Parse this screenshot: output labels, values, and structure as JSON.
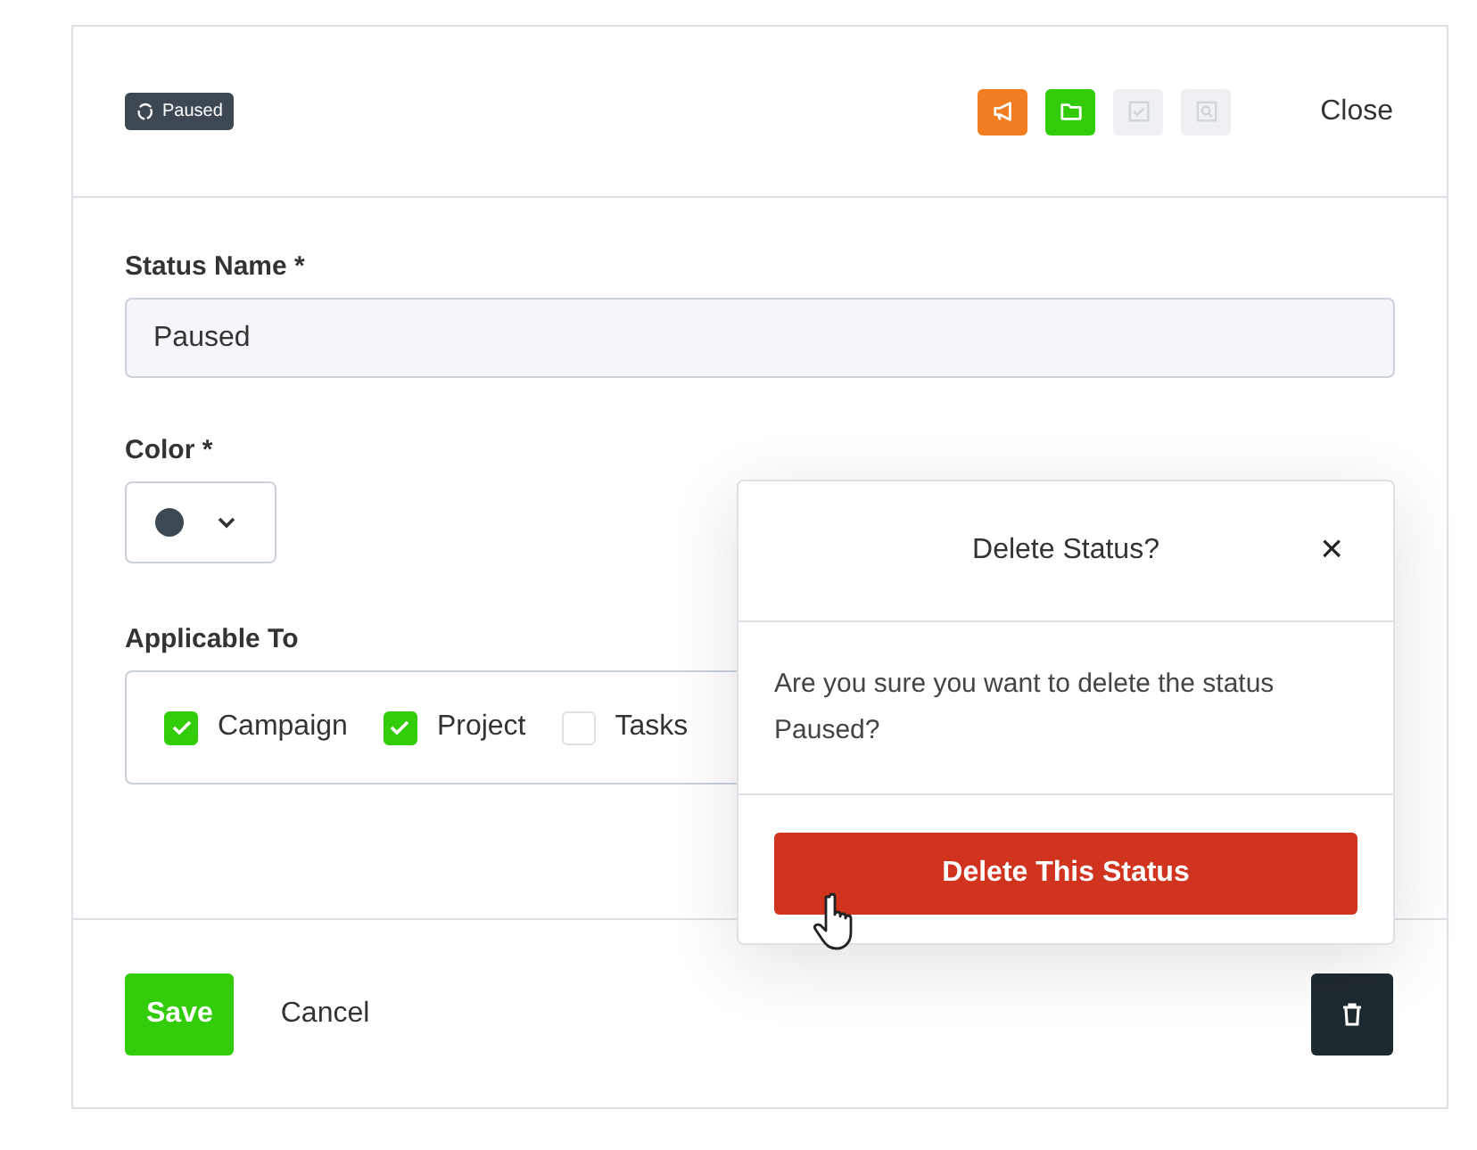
{
  "header": {
    "status_badge": "Paused",
    "toolbar_icons": [
      {
        "kind": "megaphone",
        "color": "#f37e22",
        "disabled": false
      },
      {
        "kind": "folder",
        "color": "#33cc0b",
        "disabled": false
      },
      {
        "kind": "check",
        "disabled": true
      },
      {
        "kind": "search",
        "disabled": true
      }
    ],
    "close": "Close"
  },
  "form": {
    "status_name": {
      "label": "Status Name *",
      "value": "Paused"
    },
    "color": {
      "label": "Color *",
      "color": "#3d4852"
    },
    "applicable_to": {
      "label": "Applicable To",
      "options": [
        {
          "label": "Campaign",
          "checked": true
        },
        {
          "label": "Project",
          "checked": true
        },
        {
          "label": "Tasks",
          "checked": false
        }
      ]
    }
  },
  "footer": {
    "save": "Save",
    "cancel": "Cancel"
  },
  "popover": {
    "title": "Delete Status?",
    "close": "×",
    "message": "Are you sure you want to delete the status Paused?",
    "confirm": "Delete This Status"
  }
}
